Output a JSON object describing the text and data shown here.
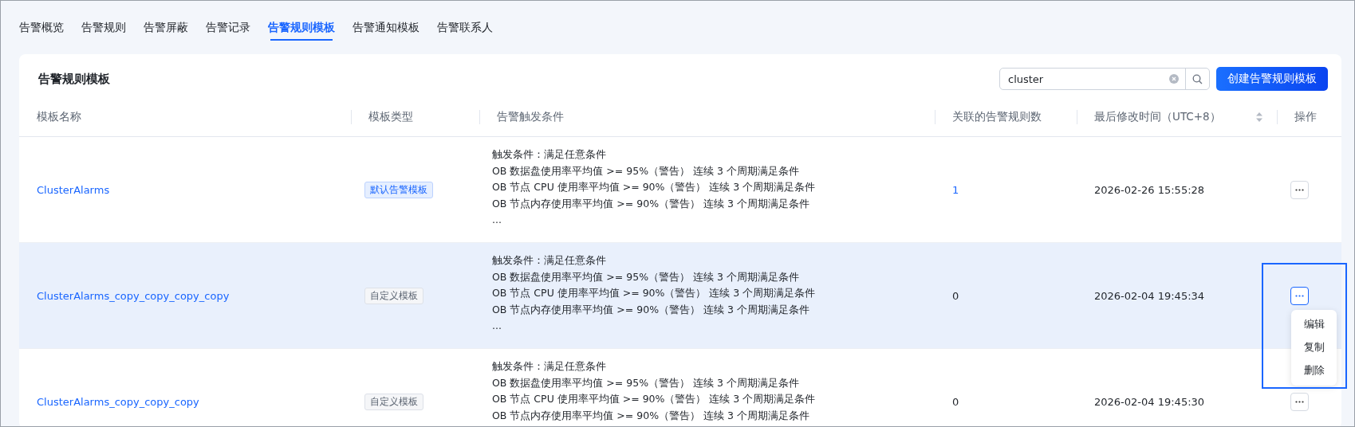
{
  "tabs": [
    {
      "label": "告警概览",
      "selected": false
    },
    {
      "label": "告警规则",
      "selected": false
    },
    {
      "label": "告警屏蔽",
      "selected": false
    },
    {
      "label": "告警记录",
      "selected": false
    },
    {
      "label": "告警规则模板",
      "selected": true
    },
    {
      "label": "告警通知模板",
      "selected": false
    },
    {
      "label": "告警联系人",
      "selected": false
    }
  ],
  "card": {
    "title": "告警规则模板",
    "search": {
      "value": "cluster"
    },
    "create_button": "创建告警规则模板"
  },
  "table": {
    "columns": [
      {
        "label": "模板名称",
        "sortable": false
      },
      {
        "label": "模板类型",
        "sortable": false
      },
      {
        "label": "告警触发条件",
        "sortable": false
      },
      {
        "label": "关联的告警规则数",
        "sortable": false
      },
      {
        "label": "最后修改时间（UTC+8）",
        "sortable": true
      },
      {
        "label": "操作",
        "sortable": false
      }
    ],
    "rows": [
      {
        "name": "ClusterAlarms",
        "type": {
          "label": "默认告警模板",
          "kind": "default"
        },
        "conditions": [
          "触发条件：满足任意条件",
          "OB 数据盘使用率平均值 >= 95%（警告） 连续 3 个周期满足条件",
          "OB 节点 CPU 使用率平均值 >= 90%（警告） 连续 3 个周期满足条件",
          "OB 节点内存使用率平均值 >= 90%（警告） 连续 3 个周期满足条件",
          "..."
        ],
        "count": "1",
        "count_linked": true,
        "modified": "2026-02-26 15:55:28",
        "highlighted": false,
        "menu_open": false
      },
      {
        "name": "ClusterAlarms_copy_copy_copy_copy",
        "type": {
          "label": "自定义模板",
          "kind": "custom"
        },
        "conditions": [
          "触发条件：满足任意条件",
          "OB 数据盘使用率平均值 >= 95%（警告） 连续 3 个周期满足条件",
          "OB 节点 CPU 使用率平均值 >= 90%（警告） 连续 3 个周期满足条件",
          "OB 节点内存使用率平均值 >= 90%（警告） 连续 3 个周期满足条件",
          "..."
        ],
        "count": "0",
        "count_linked": false,
        "modified": "2026-02-04 19:45:34",
        "highlighted": true,
        "menu_open": true
      },
      {
        "name": "ClusterAlarms_copy_copy_copy",
        "type": {
          "label": "自定义模板",
          "kind": "custom"
        },
        "conditions": [
          "触发条件：满足任意条件",
          "OB 数据盘使用率平均值 >= 95%（警告） 连续 3 个周期满足条件",
          "OB 节点 CPU 使用率平均值 >= 90%（警告） 连续 3 个周期满足条件",
          "OB 节点内存使用率平均值 >= 90%（警告） 连续 3 个周期满足条件"
        ],
        "count": "0",
        "count_linked": false,
        "modified": "2026-02-04 19:45:30",
        "highlighted": false,
        "menu_open": false
      }
    ]
  },
  "action_menu": {
    "items": [
      "编辑",
      "复制",
      "删除"
    ]
  }
}
